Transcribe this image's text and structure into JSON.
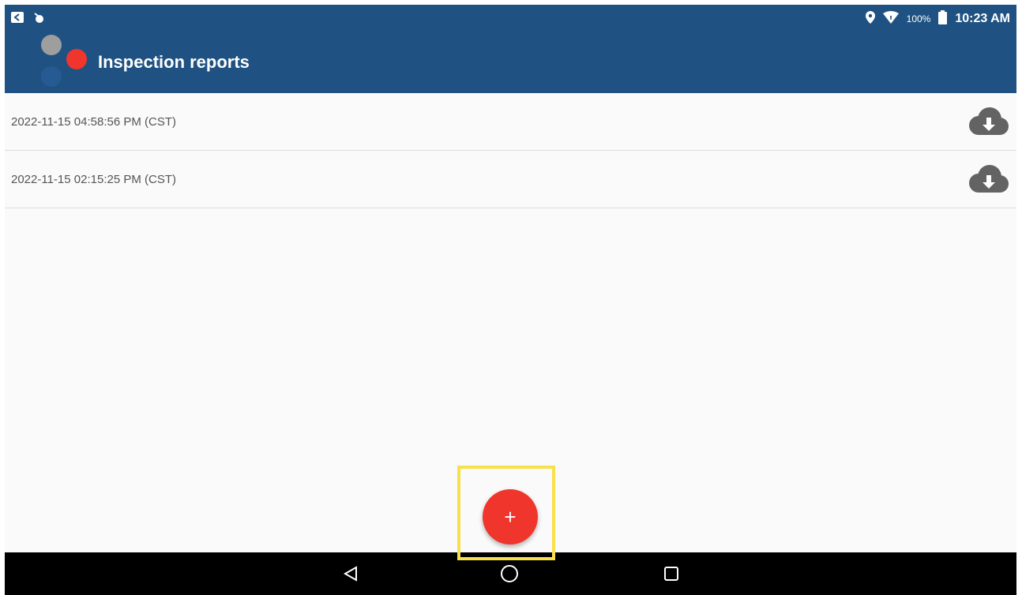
{
  "status_bar": {
    "battery": "100%",
    "time": "10:23 AM",
    "icons": [
      "notification-icon",
      "app-notification-icon",
      "location-icon",
      "wifi-icon",
      "battery-icon"
    ]
  },
  "app_bar": {
    "title": "Inspection reports",
    "logo_colors": [
      "#9e9e9e",
      "#f0362c",
      "#1f5282"
    ]
  },
  "reports": [
    {
      "date": "2022-11-15 04:58:56 PM (CST)",
      "action_icon": "cloud-download-icon"
    },
    {
      "date": "2022-11-15 02:15:25 PM (CST)",
      "action_icon": "cloud-download-icon"
    }
  ],
  "fab": {
    "label": "+",
    "color": "#f0362c"
  },
  "highlight_color": "#f7e04a",
  "nav_bar": {
    "buttons": [
      "back-icon",
      "home-icon",
      "recents-icon"
    ]
  },
  "colors": {
    "primary": "#1f5282",
    "accent": "#f0362c"
  }
}
